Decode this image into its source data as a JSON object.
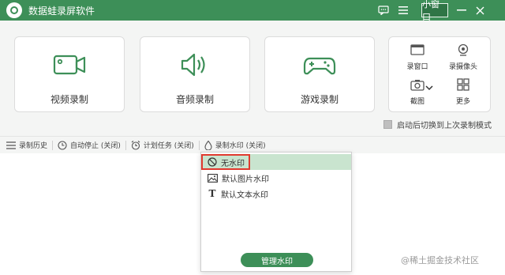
{
  "app": {
    "title": "数据蛙录屏软件"
  },
  "titlebar": {
    "mini_window_label": "小窗口"
  },
  "cards": {
    "video": "视频录制",
    "audio": "音频录制",
    "game": "游戏录制"
  },
  "tools": {
    "window": "录窗口",
    "webcam": "录摄像头",
    "screenshot": "截图",
    "more": "更多"
  },
  "startup_option": "启动后切换到上次录制模式",
  "statusbar": {
    "history": "录制历史",
    "auto_stop": "自动停止 (关闭)",
    "schedule": "计划任务 (关闭)",
    "watermark": "录制水印 (关闭)"
  },
  "watermark_menu": {
    "items": [
      "无水印",
      "默认图片水印",
      "默认文本水印"
    ],
    "selected": "无水印",
    "manage_label": "管理水印"
  },
  "page_watermark": "@稀土掘金技术社区",
  "colors": {
    "brand": "#3d8f58",
    "selected_bg": "#c9e4cf",
    "highlight_border": "#e03a2f"
  }
}
